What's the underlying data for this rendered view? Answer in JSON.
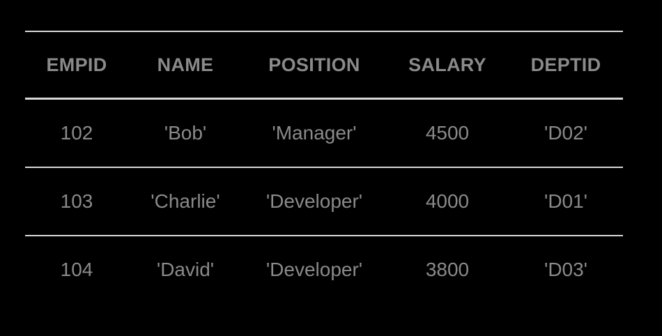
{
  "table": {
    "columns": [
      "EMPID",
      "NAME",
      "POSITION",
      "SALARY",
      "DEPTID"
    ],
    "rows": [
      [
        "102",
        "'Bob'",
        "'Manager'",
        "4500",
        "'D02'"
      ],
      [
        "103",
        "'Charlie'",
        "'Developer'",
        "4000",
        "'D01'"
      ],
      [
        "104",
        "'David'",
        "'Developer'",
        "3800",
        "'D03'"
      ]
    ]
  },
  "colors": {
    "background": "#000000",
    "text": "#8a8a8a",
    "rule": "#d9d9d9"
  }
}
